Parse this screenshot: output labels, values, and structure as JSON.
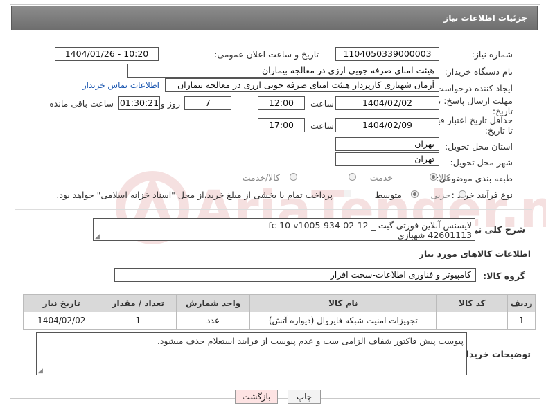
{
  "header": {
    "title": "جزئیات اطلاعات نیاز"
  },
  "labels": {
    "need_number": "شماره نیاز:",
    "announce_datetime": "تاریخ و ساعت اعلان عمومی:",
    "buyer_org": "نام دستگاه خریدار:",
    "requester": "ایجاد کننده درخواست:",
    "reply_deadline_1": "مهلت ارسال پاسخ: تا",
    "reply_deadline_2": "تاریخ:",
    "hour": "ساعت",
    "day_and": "روز و",
    "remaining": "ساعت باقی مانده",
    "price_validity_1": "حداقل تاریخ اعتبار قیمت:",
    "price_validity_2": "تا تاریخ:",
    "delivery_province": "استان محل تحویل:",
    "delivery_city": "شهر محل تحویل:",
    "category": "طبقه بندی موضوعی:",
    "process_type": "نوع فرآیند خرید :",
    "general_desc": "شرح کلی نیاز:",
    "goods_info": "اطلاعات کالاهای مورد نیاز",
    "goods_group": "گروه کالا:",
    "buyer_notes": "توضیحات خریدار:"
  },
  "values": {
    "need_number": "1104050339000003",
    "announce_datetime": "1404/01/26 - 10:20",
    "buyer_org": "هیئت امنای صرفه جویی ارزی در معالجه بیماران",
    "requester": "آرمان شهبازی کارپرداز هیئت امنای صرفه جویی ارزی در معالجه بیماران",
    "contact_link": "اطلاعات تماس خریدار",
    "reply_date": "1404/02/02",
    "reply_time": "12:00",
    "reply_days": "7",
    "reply_remaining": "01:30:21",
    "validity_date": "1404/02/09",
    "validity_time": "17:00",
    "province": "تهران",
    "city": "تهران",
    "category_options": [
      "کالا",
      "خدمت",
      "کالا/خدمت"
    ],
    "category_selected": "کالا",
    "process_options": [
      "جزیی",
      "متوسط"
    ],
    "process_selected": "متوسط",
    "payment_note": "پرداخت تمام یا بخشی از مبلغ خرید،از محل \"اسناد خزانه اسلامی\" خواهد بود.",
    "general_desc_line1": "لایسنس آنلاین فورتی گیت  _  fc-10-v1005-934-02-12",
    "general_desc_line2": "42601113 شهبازی",
    "goods_group": "کامپیوتر و فناوری اطلاعات-سخت افزار",
    "buyer_notes": "پیوست پیش فاکتور شفاف الزامی ست و عدم پیوست از فرایند استعلام حذف میشود."
  },
  "table": {
    "headers": [
      "ردیف",
      "کد کالا",
      "نام کالا",
      "واحد شمارش",
      "تعداد / مقدار",
      "تاریخ نیاز"
    ],
    "rows": [
      [
        "1",
        "--",
        "تجهیزات امنیت شبکه فایروال (دیواره آتش)",
        "عدد",
        "1",
        "1404/02/02"
      ]
    ]
  },
  "buttons": {
    "print": "چاپ",
    "back": "بازگشت"
  },
  "watermark": {
    "text": "AriaTender.neT"
  },
  "colors": {
    "header_bg": "#7d7d7d",
    "link": "#1a56b0",
    "table_header": "#d9d9d9",
    "back_button_bg": "#fde3e3",
    "watermark": "#b51c1c"
  }
}
